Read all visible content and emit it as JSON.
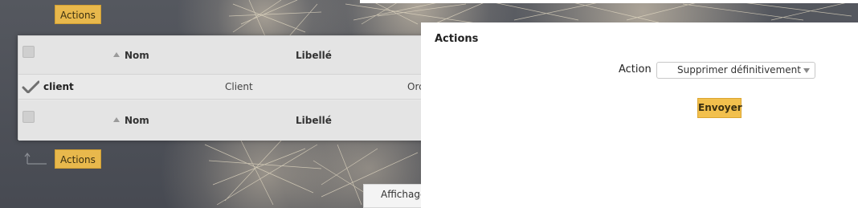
{
  "toolbar": {
    "actions_label": "Actions"
  },
  "table": {
    "columns": {
      "name": "Nom",
      "label": "Libellé"
    },
    "rows": [
      {
        "name": "client",
        "label": "Client",
        "truncated": "Orc"
      }
    ]
  },
  "modal": {
    "title": "Actions",
    "action_label": "Action",
    "selected_action": "Supprimer définitivement",
    "submit_label": "Envoyer"
  },
  "footer": {
    "display_label": "Affichage"
  },
  "colors": {
    "accent": "#f2c04d",
    "panel": "#e9e9e9",
    "background": "#4a4d55"
  }
}
